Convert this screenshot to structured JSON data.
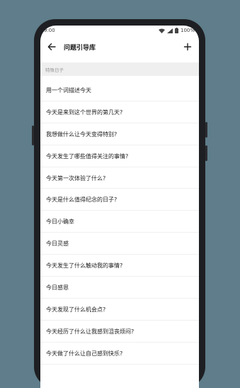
{
  "status_bar": {
    "time": "9:00",
    "battery": "100%"
  },
  "toolbar": {
    "title": "问题引导库"
  },
  "section": {
    "label": "特殊日子"
  },
  "questions": [
    "用一个词描述今天",
    "今天是来到这个世界的第几天?",
    "我想做什么让今天变得特别?",
    "今天发生了哪些值得关注的事情?",
    "今天第一次体验了什么?",
    "今天是什么值得纪念的日子?",
    "今日小确幸",
    "今日灵感",
    "今天发生了什么触动我的事情?",
    "今日感恩",
    "今天发现了什么机会点?",
    "今天经历了什么让我感到沮丧烦闷?",
    "今天做了什么让自己感到快乐?"
  ],
  "icons": {
    "back": "arrow-left-icon",
    "add": "plus-icon",
    "wifi": "wifi-icon",
    "signal": "signal-icon",
    "battery": "battery-icon"
  },
  "colors": {
    "background": "#5f7d8a",
    "phone_body": "#1e1f22",
    "section_bg": "#efefef"
  }
}
